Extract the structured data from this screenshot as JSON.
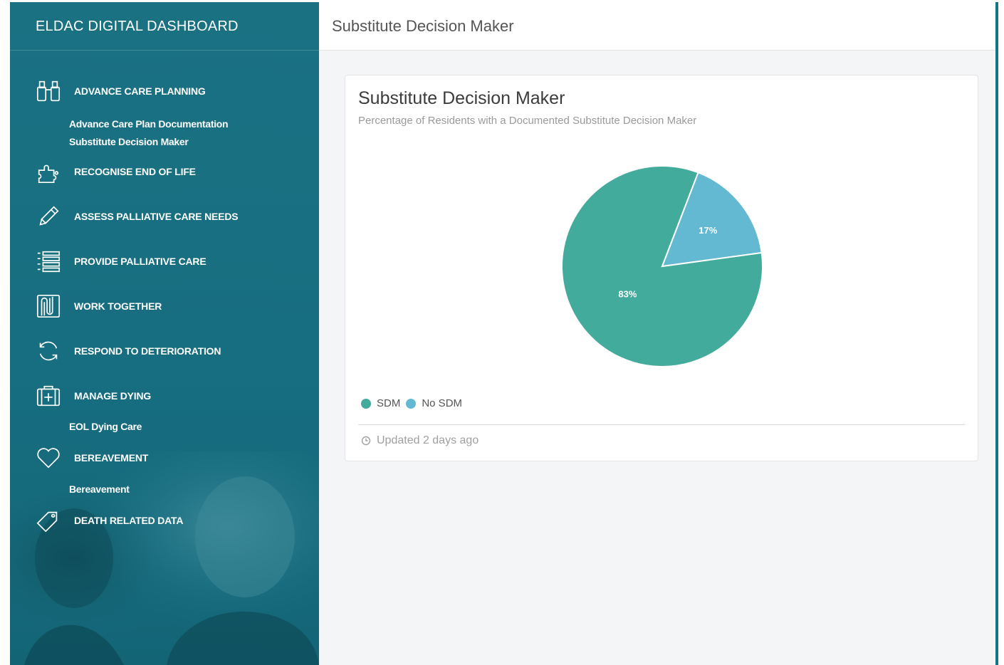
{
  "app": {
    "title": "ELDAC DIGITAL DASHBOARD"
  },
  "header": {
    "title": "Substitute Decision Maker"
  },
  "sidebar": {
    "items": [
      {
        "label": "ADVANCE CARE PLANNING",
        "icon": "binoculars-icon",
        "subitems": [
          "Advance Care Plan Documentation",
          "Substitute Decision Maker"
        ]
      },
      {
        "label": "RECOGNISE END OF LIFE",
        "icon": "puzzle-icon",
        "subitems": []
      },
      {
        "label": "ASSESS PALLIATIVE CARE NEEDS",
        "icon": "pencil-icon",
        "subitems": []
      },
      {
        "label": "PROVIDE PALLIATIVE CARE",
        "icon": "list-icon",
        "subitems": []
      },
      {
        "label": "WORK TOGETHER",
        "icon": "interlock-icon",
        "subitems": []
      },
      {
        "label": "RESPOND TO DETERIORATION",
        "icon": "refresh-icon",
        "subitems": []
      },
      {
        "label": "MANAGE DYING",
        "icon": "medical-kit-icon",
        "subitems": [
          "EOL Dying Care"
        ]
      },
      {
        "label": "BEREAVEMENT",
        "icon": "heart-icon",
        "subitems": [
          "Bereavement"
        ]
      },
      {
        "label": "DEATH RELATED DATA",
        "icon": "tag-icon",
        "subitems": []
      }
    ]
  },
  "card": {
    "title": "Substitute Decision Maker",
    "subtitle": "Percentage of Residents with a Documented Substitute Decision Maker",
    "updated": "Updated 2 days ago"
  },
  "colors": {
    "sdm": "#43ab9b",
    "no_sdm": "#63b8d2",
    "sidebar": "#176e80"
  },
  "chart_data": {
    "type": "pie",
    "categories": [
      "SDM",
      "No SDM"
    ],
    "values": [
      83,
      17
    ],
    "value_labels": [
      "83%",
      "17%"
    ],
    "legend_position": "bottom-left"
  }
}
